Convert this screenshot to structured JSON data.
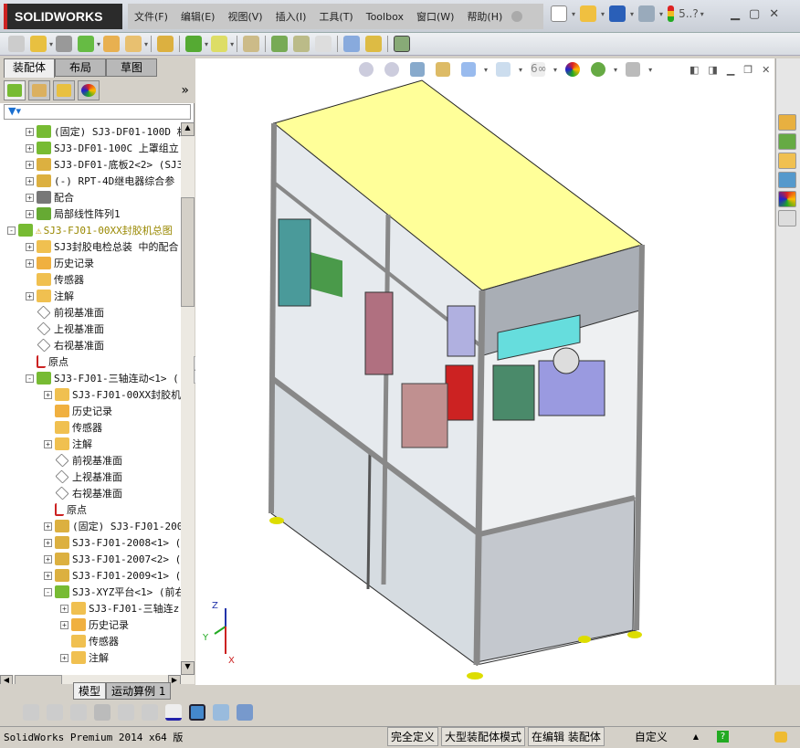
{
  "app": {
    "logo_text": "SOLIDWORKS"
  },
  "menu": [
    "文件(F)",
    "编辑(E)",
    "视图(V)",
    "插入(I)",
    "工具(T)",
    "Toolbox",
    "窗口(W)",
    "帮助(H)"
  ],
  "quick_access": {
    "help_text": "5..?"
  },
  "panel_tabs": [
    "装配体",
    "布局",
    "草图"
  ],
  "panel_more": "»",
  "filter_icon": "funnel-icon",
  "tree": [
    {
      "level": 1,
      "exp": "+",
      "icon": "assembly-icon",
      "text": "(固定) SJ3-DF01-100D 机"
    },
    {
      "level": 1,
      "exp": "+",
      "icon": "assembly-icon",
      "text": "SJ3-DF01-100C 上罩组立"
    },
    {
      "level": 1,
      "exp": "+",
      "icon": "part-icon",
      "text": "SJ3-DF01-底板2<2> (SJ3-"
    },
    {
      "level": 1,
      "exp": "+",
      "icon": "part-icon",
      "text": "(-) RPT-4D继电器综合参"
    },
    {
      "level": 1,
      "exp": "+",
      "icon": "mates-icon",
      "text": "配合"
    },
    {
      "level": 1,
      "exp": "+",
      "icon": "pattern-icon",
      "text": "局部线性阵列1"
    },
    {
      "level": 0,
      "exp": "-",
      "icon": "assembly-icon",
      "warn": true,
      "text": "SJ3-FJ01-00XX封胶机总图"
    },
    {
      "level": 1,
      "exp": "+",
      "icon": "folder-mates-icon",
      "text": "SJ3封胶电检总装 中的配合"
    },
    {
      "level": 1,
      "exp": "+",
      "icon": "history-icon",
      "text": "历史记录"
    },
    {
      "level": 1,
      "exp": "",
      "icon": "sensor-icon",
      "text": "传感器"
    },
    {
      "level": 1,
      "exp": "+",
      "icon": "annotation-icon",
      "text": "注解"
    },
    {
      "level": 1,
      "exp": "",
      "icon": "plane-icon",
      "text": "前视基准面"
    },
    {
      "level": 1,
      "exp": "",
      "icon": "plane-icon",
      "text": "上视基准面"
    },
    {
      "level": 1,
      "exp": "",
      "icon": "plane-icon",
      "text": "右视基准面"
    },
    {
      "level": 1,
      "exp": "",
      "icon": "origin-icon",
      "text": "原点"
    },
    {
      "level": 1,
      "exp": "-",
      "icon": "assembly-icon",
      "text": "SJ3-FJ01-三轴连动<1> ("
    },
    {
      "level": 2,
      "exp": "+",
      "icon": "folder-mates-icon",
      "text": "SJ3-FJ01-00XX封胶机."
    },
    {
      "level": 2,
      "exp": "",
      "icon": "history-icon",
      "text": "历史记录"
    },
    {
      "level": 2,
      "exp": "",
      "icon": "sensor-icon",
      "text": "传感器"
    },
    {
      "level": 2,
      "exp": "+",
      "icon": "annotation-icon",
      "text": "注解"
    },
    {
      "level": 2,
      "exp": "",
      "icon": "plane-icon",
      "text": "前视基准面"
    },
    {
      "level": 2,
      "exp": "",
      "icon": "plane-icon",
      "text": "上视基准面"
    },
    {
      "level": 2,
      "exp": "",
      "icon": "plane-icon",
      "text": "右视基准面"
    },
    {
      "level": 2,
      "exp": "",
      "icon": "origin-icon",
      "text": "原点"
    },
    {
      "level": 2,
      "exp": "+",
      "icon": "part-icon",
      "text": "(固定) SJ3-FJ01-2007"
    },
    {
      "level": 2,
      "exp": "+",
      "icon": "part-icon",
      "text": "SJ3-FJ01-2008<1> (S."
    },
    {
      "level": 2,
      "exp": "+",
      "icon": "part-icon",
      "text": "SJ3-FJ01-2007<2> (S."
    },
    {
      "level": 2,
      "exp": "+",
      "icon": "part-icon",
      "text": "SJ3-FJ01-2009<1> (S."
    },
    {
      "level": 2,
      "exp": "-",
      "icon": "assembly-icon",
      "text": "SJ3-XYZ平台<1> (前右"
    },
    {
      "level": 3,
      "exp": "+",
      "icon": "folder-mates-icon",
      "text": "SJ3-FJ01-三轴连z"
    },
    {
      "level": 3,
      "exp": "+",
      "icon": "history-icon",
      "text": "历史记录"
    },
    {
      "level": 3,
      "exp": "",
      "icon": "sensor-icon",
      "text": "传感器"
    },
    {
      "level": 3,
      "exp": "+",
      "icon": "annotation-icon",
      "text": "注解"
    }
  ],
  "bottom_tabs": [
    "模型",
    "运动算例 1"
  ],
  "triad": {
    "x": "X",
    "y": "Y",
    "z": "Z"
  },
  "status": {
    "product": "SolidWorks Premium 2014 x64 版",
    "definition": "完全定义",
    "mode": "大型装配体模式",
    "editing": "在编辑 装配体",
    "units": "自定义",
    "up_arrow": "▲"
  },
  "colors": {
    "yellow_top": "#ffff99",
    "frame": "#9aa0a8",
    "accent_red": "#cc2222"
  }
}
